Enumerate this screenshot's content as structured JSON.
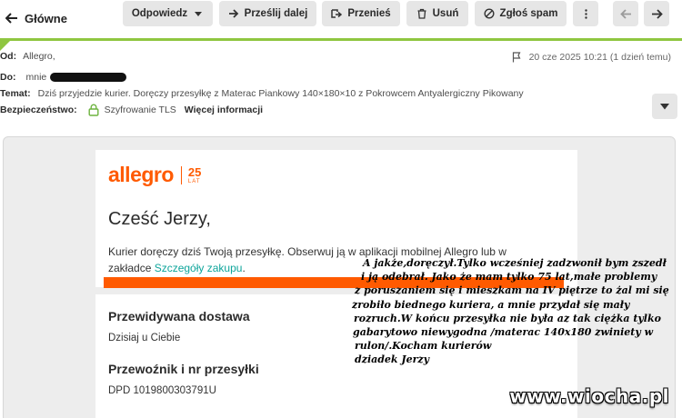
{
  "toolbar": {
    "back_label": "Główne",
    "reply_label": "Odpowiedz",
    "forward_label": "Prześlij dalej",
    "move_label": "Przenieś",
    "delete_label": "Usuń",
    "spam_label": "Zgłoś spam"
  },
  "header": {
    "from_label": "Od:",
    "from_value": "Allegro,",
    "date_value": "20 cze 2025 10:21 (1 dzień temu)",
    "to_label": "Do:",
    "to_value": "mnie",
    "subject_label": "Temat:",
    "subject_value": "Dziś przyjedzie kurier. Doręczy przesyłkę z Materac Piankowy 140×180×10 z Pokrowcem Antyalergiczny Pikowany",
    "security_label": "Bezpieczeństwo:",
    "security_value": "Szyfrowanie TLS",
    "more_info_label": "Więcej informacji"
  },
  "message": {
    "logo_word": "allegro",
    "logo_number": "25",
    "logo_small": "LAT",
    "greeting": "Cześć Jerzy,",
    "body_before_link": "Kurier doręczy dziś Twoją przesyłkę. Obserwuj ją w aplikacji mobilnej Allegro lub w zakładce ",
    "body_link": "Szczegóły zakupu",
    "body_after_link": ".",
    "delivery_title": "Przewidywana dostawa",
    "delivery_value": "Dzisiaj u Ciebie",
    "carrier_title": "Przewoźnik i nr przesyłki",
    "carrier_value": "DPD 1019800303791U"
  },
  "note": {
    "lines": [
      "A jakże,doręczył.Tylko wcześniej zadzwonił bym zszedł",
      "i ją odebrał. Jako że mam tylko 75 lat,małe problemy",
      "z poruszaniem się i mieszkam na IV piętrze to  żal mi się",
      "zrobiło biednego kuriera, a mnie przydał się mały",
      "rozruch.W końcu przesyłka nie była az tak ciężka tylko",
      "gabarytowo niewygodna /materac 140x180 zwiniety w",
      "rulon/.Kocham kurierów",
      "dziadek Jerzy"
    ]
  },
  "watermark": "www.wiocha.pl",
  "colors": {
    "accent_green": "#8fc640",
    "allegro_orange": "#ff5a00",
    "link_teal": "#0ea59b"
  },
  "icons": [
    "arrow-left-icon",
    "forward-icon",
    "move-icon",
    "trash-icon",
    "spam-icon",
    "more-vert-icon",
    "arrow-right-icon",
    "lock-icon",
    "flag-icon",
    "chevron-down-icon"
  ]
}
